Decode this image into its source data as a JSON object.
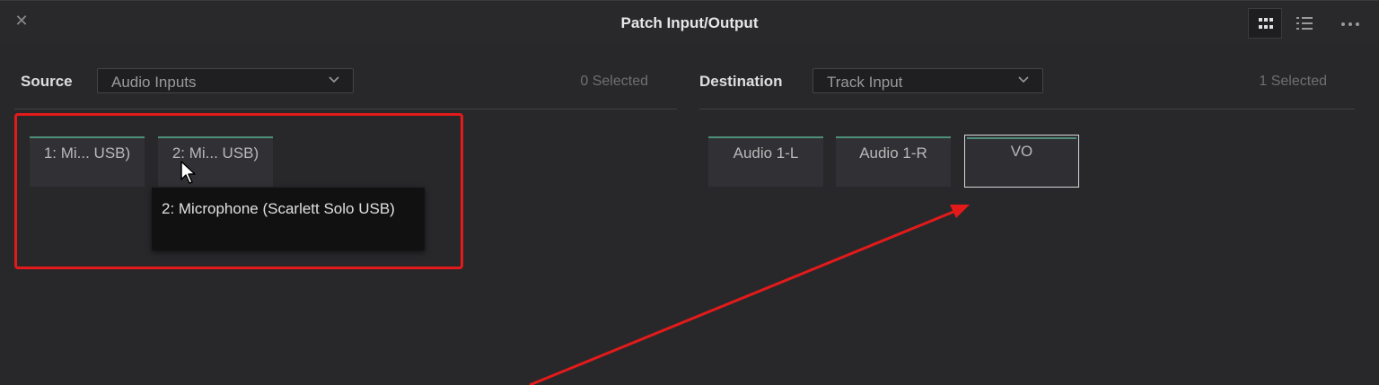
{
  "window": {
    "title": "Patch Input/Output",
    "close_icon": "close-icon",
    "view_buttons": [
      "grid-view-icon",
      "list-view-icon",
      "more-options-icon"
    ]
  },
  "source": {
    "label": "Source",
    "dropdown_value": "Audio Inputs",
    "selected_count": "0 Selected",
    "chips": [
      {
        "label": "1: Mi... USB)"
      },
      {
        "label": "2: Mi... USB)"
      }
    ],
    "tooltip": "2: Microphone (Scarlett Solo USB)"
  },
  "destination": {
    "label": "Destination",
    "dropdown_value": "Track Input",
    "selected_count": "1 Selected",
    "chips": [
      {
        "label": "Audio 1-L"
      },
      {
        "label": "Audio 1-R"
      },
      {
        "label": "VO"
      }
    ]
  },
  "annotations": {
    "highlight_color": "#e41a1a",
    "arrow_color": "#e41a1a",
    "accent_color": "#4e8f78"
  }
}
